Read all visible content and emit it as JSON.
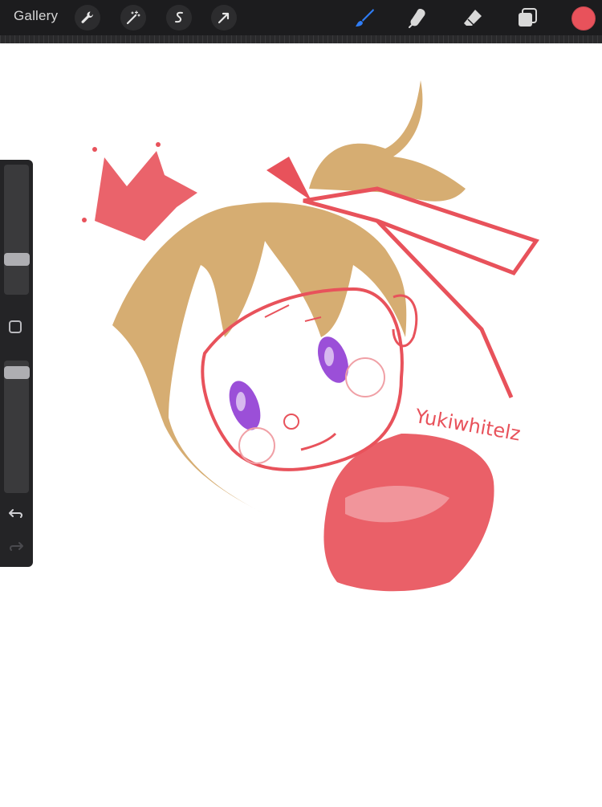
{
  "toolbar": {
    "gallery_label": "Gallery",
    "left_tools": [
      {
        "name": "actions",
        "icon": "wrench-icon"
      },
      {
        "name": "adjustments",
        "icon": "magic-wand-icon"
      },
      {
        "name": "selection",
        "icon": "selection-s-icon"
      },
      {
        "name": "transform",
        "icon": "arrow-cursor-icon"
      }
    ],
    "right_tools": [
      {
        "name": "brush",
        "icon": "brush-icon",
        "active": true
      },
      {
        "name": "smudge",
        "icon": "smudge-icon",
        "active": false
      },
      {
        "name": "eraser",
        "icon": "eraser-icon",
        "active": false
      },
      {
        "name": "layers",
        "icon": "layers-icon",
        "active": false
      }
    ],
    "current_color": "#e8525b",
    "active_tool_color": "#2f7df6"
  },
  "sidebar": {
    "brush_size_level": 0.25,
    "opacity_level": 0.95,
    "modify_button_icon": "square-icon",
    "undo_icon": "undo-icon",
    "redo_icon": "redo-icon",
    "redo_enabled": false
  },
  "artwork": {
    "signature": "Yukiwhitelz",
    "colors": {
      "line": "#e8525b",
      "hair": "#d4a96a",
      "eyes": "#9b4fd8"
    }
  }
}
